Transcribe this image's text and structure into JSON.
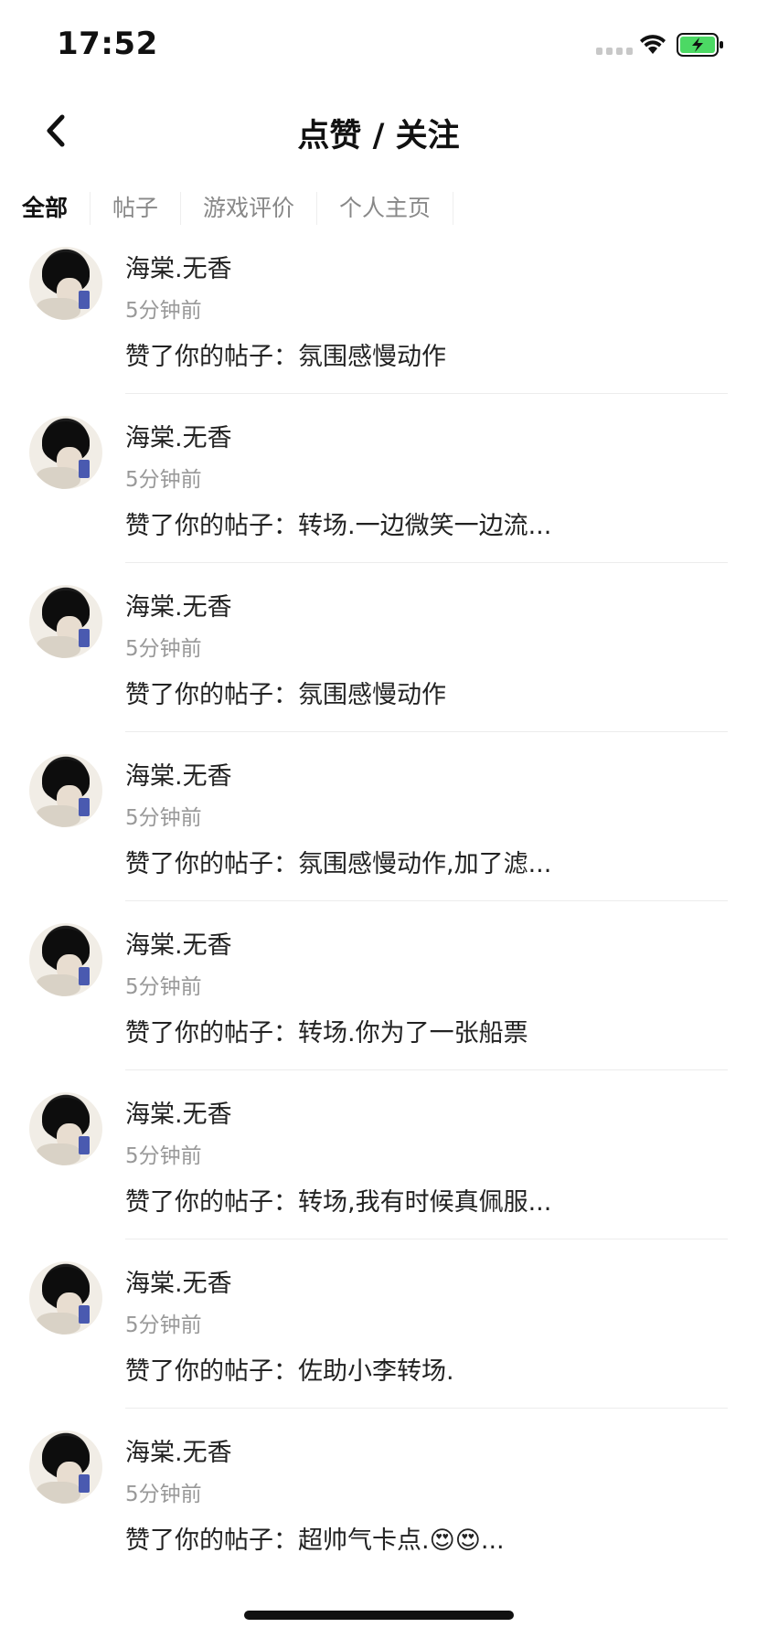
{
  "status_bar": {
    "time": "17:52"
  },
  "nav": {
    "title": "点赞 / 关注"
  },
  "tabs": [
    {
      "label": "全部",
      "active": true
    },
    {
      "label": "帖子",
      "active": false
    },
    {
      "label": "游戏评价",
      "active": false
    },
    {
      "label": "个人主页",
      "active": false
    }
  ],
  "items": [
    {
      "name": "海棠.无香",
      "time": "5分钟前",
      "text": "赞了你的帖子：氛围感慢动作"
    },
    {
      "name": "海棠.无香",
      "time": "5分钟前",
      "text": "赞了你的帖子：转场.一边微笑一边流..."
    },
    {
      "name": "海棠.无香",
      "time": "5分钟前",
      "text": "赞了你的帖子：氛围感慢动作"
    },
    {
      "name": "海棠.无香",
      "time": "5分钟前",
      "text": "赞了你的帖子：氛围感慢动作,加了滤..."
    },
    {
      "name": "海棠.无香",
      "time": "5分钟前",
      "text": "赞了你的帖子：转场.你为了一张船票"
    },
    {
      "name": "海棠.无香",
      "time": "5分钟前",
      "text": "赞了你的帖子：转场,我有时候真佩服..."
    },
    {
      "name": "海棠.无香",
      "time": "5分钟前",
      "text": "赞了你的帖子：佐助小李转场."
    },
    {
      "name": "海棠.无香",
      "time": "5分钟前",
      "text": "赞了你的帖子：超帅气卡点.😍😍..."
    }
  ],
  "colors": {
    "accent_battery": "#4cd964",
    "text_primary": "#222222",
    "text_secondary": "#999999"
  }
}
